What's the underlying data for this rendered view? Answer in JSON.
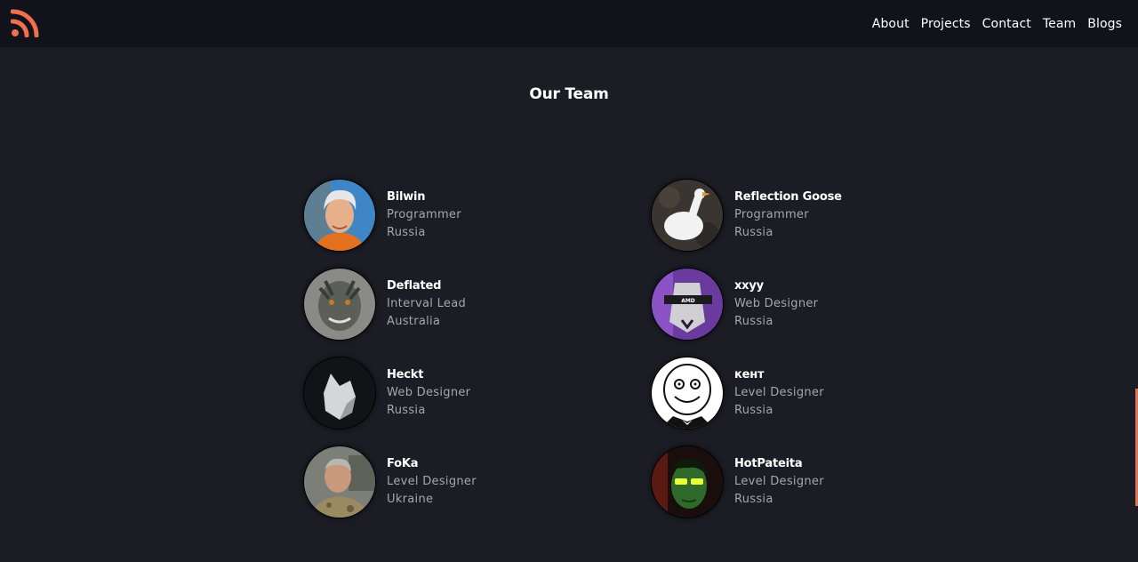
{
  "header": {
    "logo_icon": "rss-feed-icon",
    "nav": [
      {
        "label": "About"
      },
      {
        "label": "Projects"
      },
      {
        "label": "Contact"
      },
      {
        "label": "Team"
      },
      {
        "label": "Blogs"
      }
    ]
  },
  "main": {
    "title": "Our Team",
    "members": [
      {
        "name": "Bilwin",
        "role": "Programmer",
        "country": "Russia"
      },
      {
        "name": "Reflection Goose",
        "role": "Programmer",
        "country": "Russia"
      },
      {
        "name": "Deflated",
        "role": "Interval Lead",
        "country": "Australia"
      },
      {
        "name": "xxyy",
        "role": "Web Designer",
        "country": "Russia"
      },
      {
        "name": "Heckt",
        "role": "Web Designer",
        "country": "Russia"
      },
      {
        "name": "кент",
        "role": "Level Designer",
        "country": "Russia"
      },
      {
        "name": "FoKa",
        "role": "Level Designer",
        "country": "Ukraine"
      },
      {
        "name": "HotPateita",
        "role": "Level Designer",
        "country": "Russia"
      }
    ],
    "avatar_banner_text": "AMD"
  },
  "colors": {
    "background": "#1b1c24",
    "header": "#12131a",
    "accent": "#ef6f4f",
    "muted_text": "#a6a7ad"
  }
}
